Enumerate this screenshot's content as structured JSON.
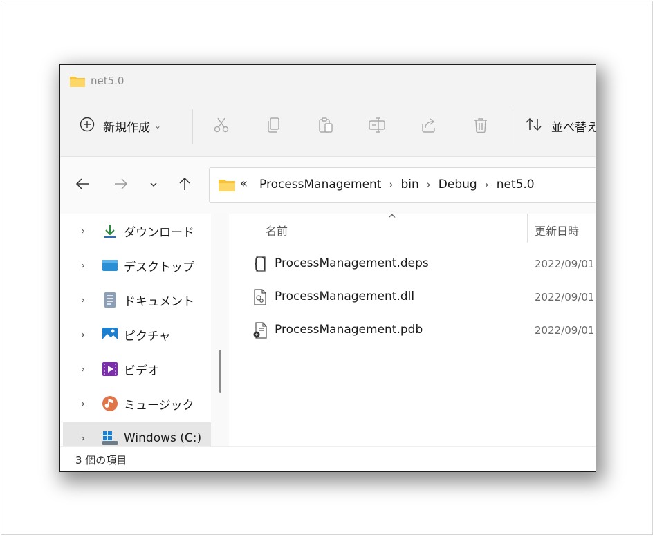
{
  "window": {
    "title": "net5.0"
  },
  "toolbar": {
    "new_label": "新規作成",
    "new_caret": "⌄",
    "sort_label": "並べ替え"
  },
  "nav": {
    "back": "←",
    "forward": "→",
    "recent": "⌄",
    "up": "↑"
  },
  "address": {
    "overflow": "«",
    "separator": "›",
    "crumbs": [
      "ProcessManagement",
      "bin",
      "Debug",
      "net5.0"
    ]
  },
  "sidebar": {
    "chevron": "›",
    "items": [
      {
        "label": "ダウンロード",
        "icon": "download-icon"
      },
      {
        "label": "デスクトップ",
        "icon": "desktop-icon"
      },
      {
        "label": "ドキュメント",
        "icon": "documents-icon"
      },
      {
        "label": "ピクチャ",
        "icon": "pictures-icon"
      },
      {
        "label": "ビデオ",
        "icon": "videos-icon"
      },
      {
        "label": "ミュージック",
        "icon": "music-icon"
      },
      {
        "label": "Windows (C:)",
        "icon": "drive-icon"
      }
    ]
  },
  "list": {
    "sort_indicator": "^",
    "columns": {
      "name": "名前",
      "date": "更新日時"
    },
    "files": [
      {
        "name": "ProcessManagement.deps",
        "date": "2022/09/01",
        "icon": "json-file-icon"
      },
      {
        "name": "ProcessManagement.dll",
        "date": "2022/09/01",
        "icon": "dll-file-icon"
      },
      {
        "name": "ProcessManagement.pdb",
        "date": "2022/09/01",
        "icon": "pdb-file-icon"
      }
    ]
  },
  "status": {
    "count_text": "3 個の項目"
  },
  "colors": {
    "accent": "#0067c0",
    "folder": "#f8c33b",
    "toolbar_bg": "#f3f3f3"
  }
}
